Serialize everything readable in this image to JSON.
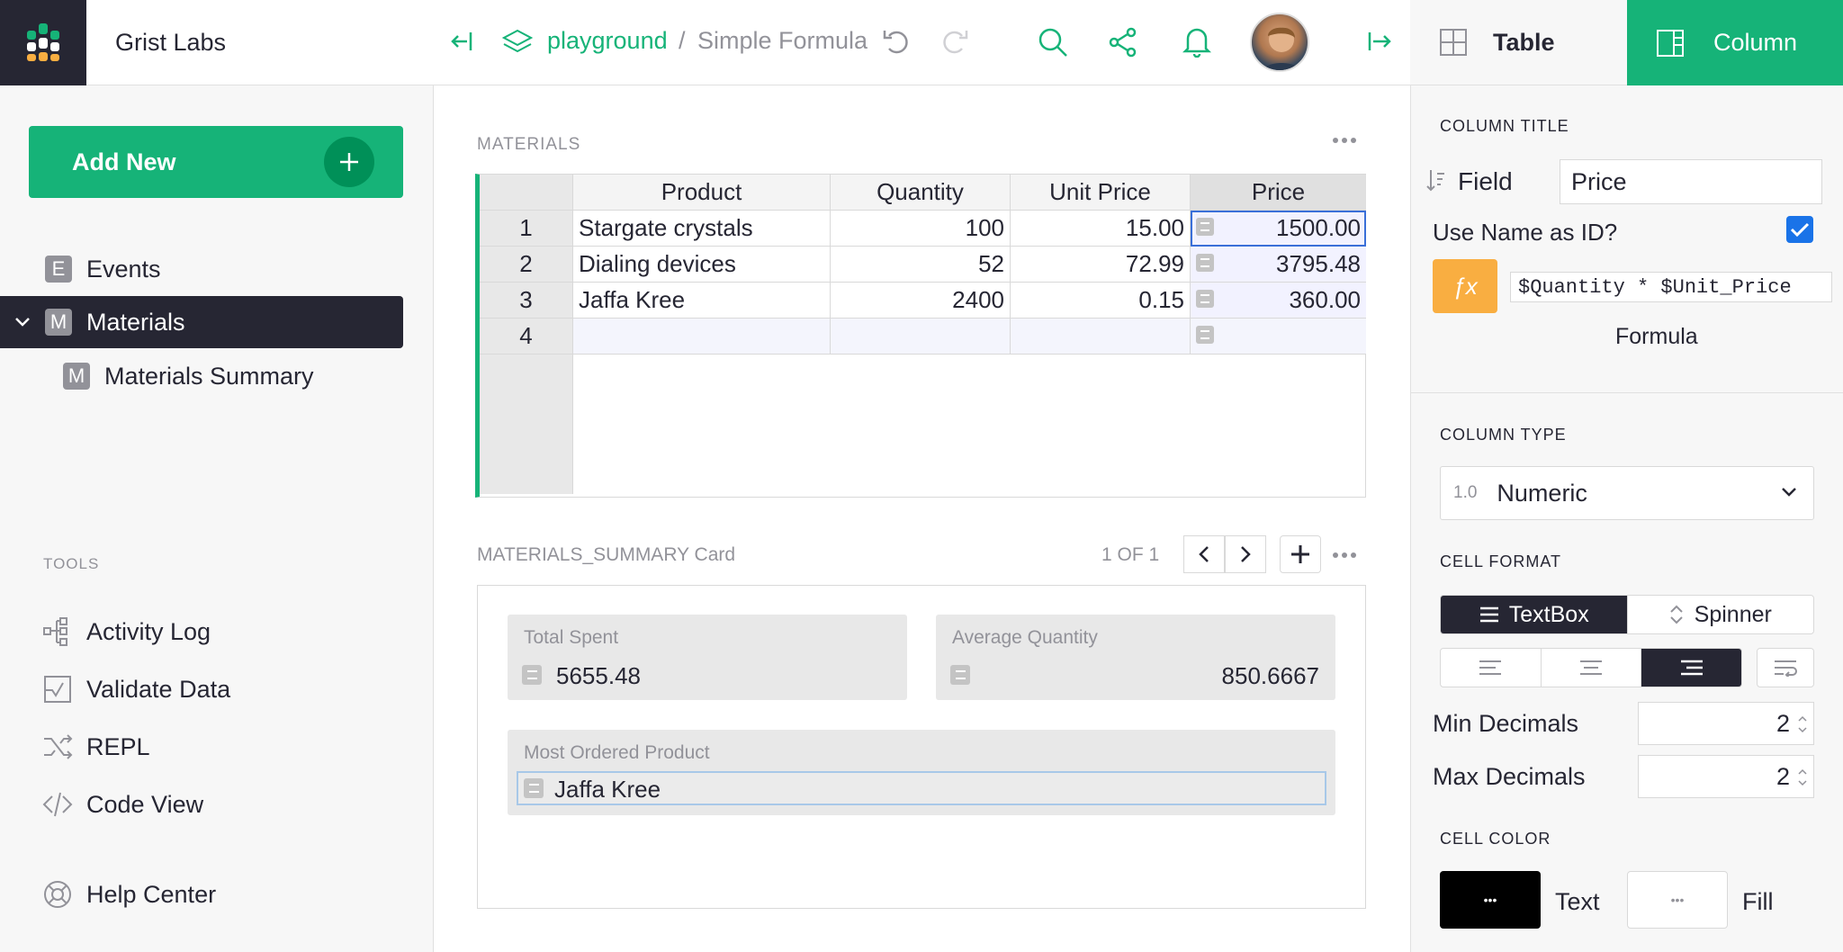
{
  "org_name": "Grist Labs",
  "add_new_label": "Add New",
  "pages": [
    {
      "badge": "E",
      "label": "Events"
    },
    {
      "badge": "M",
      "label": "Materials"
    },
    {
      "badge": "M",
      "label": "Materials Summary"
    }
  ],
  "tools": {
    "label": "TOOLS",
    "items": [
      "Activity Log",
      "Validate Data",
      "REPL",
      "Code View"
    ],
    "help": "Help Center"
  },
  "breadcrumb": {
    "doc": "playground",
    "sep": "/",
    "page": "Simple Formula"
  },
  "right_tabs": {
    "table": "Table",
    "column": "Column"
  },
  "column_panel": {
    "title_label": "COLUMN TITLE",
    "field_label": "Field",
    "field_value": "Price",
    "use_name_label": "Use Name as ID?",
    "formula": "$Quantity * $Unit_Price",
    "formula_label": "Formula",
    "type_label": "COLUMN TYPE",
    "type_icon": "1.0",
    "type_value": "Numeric",
    "cell_format_label": "CELL FORMAT",
    "format_textbox": "TextBox",
    "format_spinner": "Spinner",
    "min_decimals_label": "Min Decimals",
    "min_decimals": "2",
    "max_decimals_label": "Max Decimals",
    "max_decimals": "2",
    "cell_color_label": "CELL COLOR",
    "text_label": "Text",
    "fill_label": "Fill",
    "ellipsis": "•••"
  },
  "materials": {
    "title": "MATERIALS",
    "columns": [
      "Product",
      "Quantity",
      "Unit Price",
      "Price"
    ],
    "rows": [
      {
        "num": "1",
        "product": "Stargate crystals",
        "quantity": "100",
        "unit_price": "15.00",
        "price": "1500.00"
      },
      {
        "num": "2",
        "product": "Dialing devices",
        "quantity": "52",
        "unit_price": "72.99",
        "price": "3795.48"
      },
      {
        "num": "3",
        "product": "Jaffa Kree",
        "quantity": "2400",
        "unit_price": "0.15",
        "price": "360.00"
      },
      {
        "num": "4",
        "product": "",
        "quantity": "",
        "unit_price": "",
        "price": ""
      }
    ]
  },
  "summary_card": {
    "title": "MATERIALS_SUMMARY Card",
    "count": "1 OF 1",
    "total_spent_label": "Total Spent",
    "total_spent": "5655.48",
    "avg_qty_label": "Average Quantity",
    "avg_qty": "850.6667",
    "most_ordered_label": "Most Ordered Product",
    "most_ordered": "Jaffa Kree"
  },
  "colors": {
    "accent": "#16b378",
    "dark": "#262633",
    "formula_orange": "#f9ae41"
  }
}
